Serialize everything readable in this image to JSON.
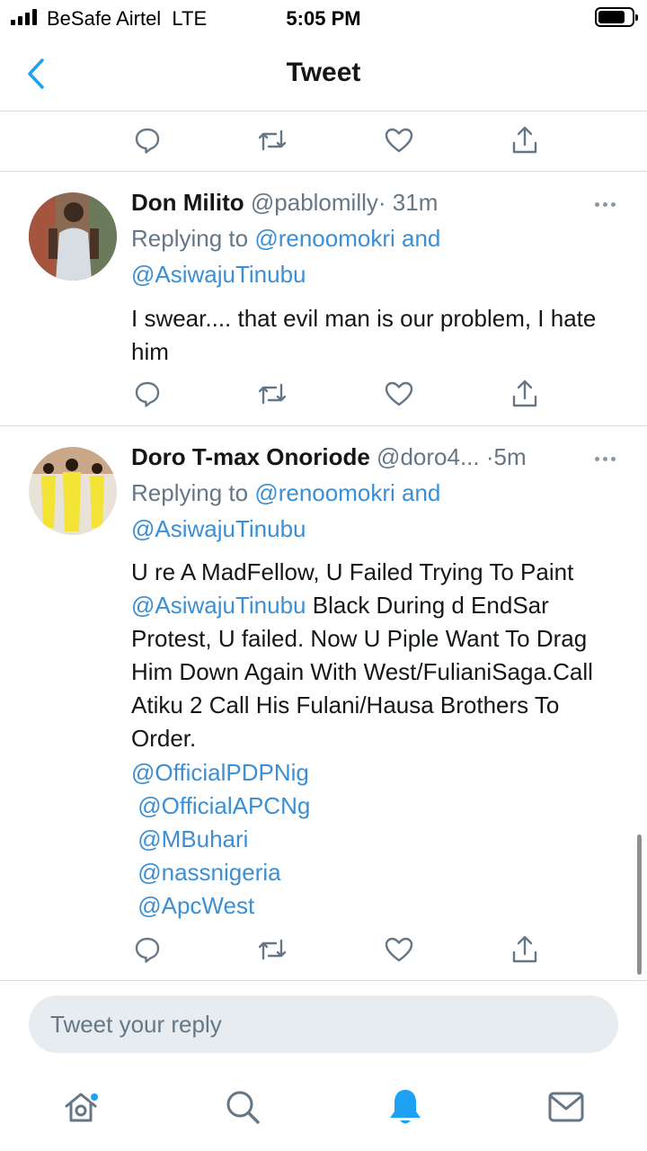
{
  "status_bar": {
    "carrier": "BeSafe Airtel  LTE",
    "time": "5:05 PM"
  },
  "nav": {
    "title": "Tweet"
  },
  "tweets": [
    {
      "name": "Don Milito",
      "handle": "@pablomilly",
      "separator": "·",
      "time": "31m",
      "replying_prefix": "Replying to",
      "replying_to_1": "@renoomokri",
      "replying_and": "and",
      "replying_to_2": "@AsiwajuTinubu",
      "text": "I swear.... that evil man is our problem, I hate him"
    },
    {
      "name": "Doro T-max Onoriode",
      "handle": "@doro4...",
      "separator": "·",
      "time": "5m",
      "replying_prefix": "Replying to",
      "replying_to_1": "@renoomokri",
      "replying_and": "and",
      "replying_to_2": "@AsiwajuTinubu",
      "text_part1": "U re A MadFellow, U Failed Trying To Paint ",
      "text_mention": "@AsiwajuTinubu",
      "text_part2": " Black During d EndSar Protest, U failed. Now U Piple Want To Drag Him Down Again With West/FulianiSaga.Call Atiku 2 Call His Fulani/Hausa Brothers To Order.",
      "mentions": [
        "@OfficialPDPNig",
        " @OfficialAPCNg",
        " @MBuhari",
        " @nassnigeria",
        " @ApcWest"
      ]
    }
  ],
  "actions": {
    "reply_icon": "reply-icon",
    "retweet_icon": "retweet-icon",
    "like_icon": "heart-icon",
    "share_icon": "share-icon"
  },
  "reply_box": {
    "placeholder": "Tweet your reply"
  },
  "tab_bar": {
    "items": [
      "home-icon",
      "search-icon",
      "notifications-icon",
      "messages-icon"
    ]
  },
  "colors": {
    "accent": "#1da1f2",
    "link": "#3b8fd4",
    "secondary_text": "#657786",
    "icon_gray": "#657786"
  }
}
